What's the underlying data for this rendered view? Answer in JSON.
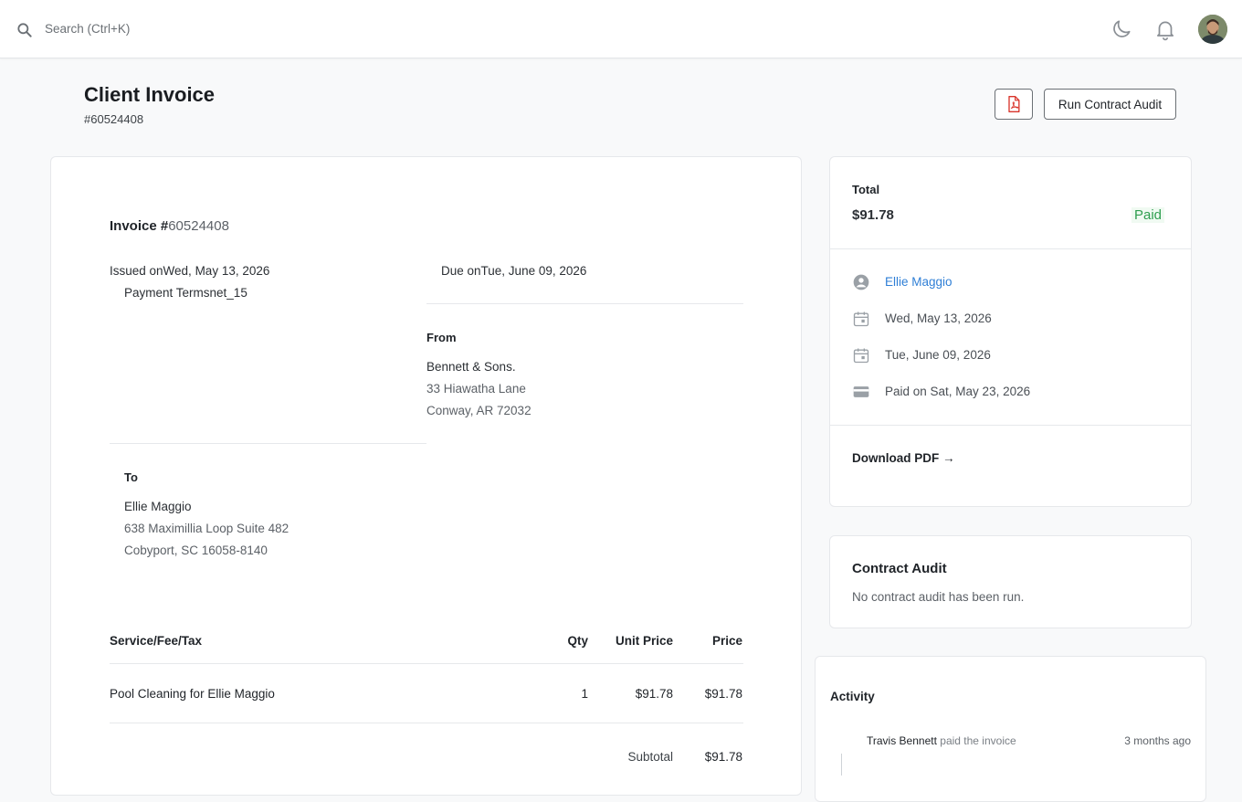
{
  "topbar": {
    "search_placeholder": "Search (Ctrl+K)"
  },
  "header": {
    "title": "Client Invoice",
    "subtitle": "#60524408",
    "audit_button": "Run Contract Audit"
  },
  "invoice": {
    "title_prefix": "Invoice #",
    "number": "60524408",
    "issued_label": "Issued on",
    "issued_date": "Wed, May 13, 2026",
    "due_label": "Due on",
    "due_date": "Tue, June 09, 2026",
    "terms_label": "Payment Terms",
    "terms_value": "net_15",
    "from": {
      "label": "From",
      "name": "Bennett & Sons.",
      "line1": "33 Hiawatha Lane",
      "line2": "Conway, AR 72032"
    },
    "to": {
      "label": "To",
      "name": "Ellie Maggio",
      "line1": "638 Maximillia Loop Suite 482",
      "line2": "Cobyport, SC 16058-8140"
    },
    "table": {
      "headers": [
        "Service/Fee/Tax",
        "Qty",
        "Unit Price",
        "Price"
      ],
      "rows": [
        {
          "service": "Pool Cleaning for Ellie Maggio",
          "qty": "1",
          "unit_price": "$91.78",
          "price": "$91.78"
        }
      ],
      "subtotal_label": "Subtotal",
      "subtotal_value": "$91.78"
    }
  },
  "summary": {
    "total_label": "Total",
    "total_value": "$91.78",
    "status": "Paid",
    "client": "Ellie Maggio",
    "issued": "Wed, May 13, 2026",
    "due": "Tue, June 09, 2026",
    "paid_on": "Paid on Sat, May 23, 2026",
    "download": "Download PDF →"
  },
  "contract_audit": {
    "title": "Contract Audit",
    "text": "No contract audit has been run."
  },
  "activity": {
    "title": "Activity",
    "items": [
      {
        "user": "Travis Bennett",
        "action": "paid the invoice",
        "time": "3 months ago"
      }
    ]
  },
  "colors": {
    "link": "#2f7fd6",
    "paid": "#2e9e4f",
    "pdf_red": "#d9342b"
  },
  "icons": [
    "search-icon",
    "moon-icon",
    "bell-icon",
    "pdf-icon",
    "account-circle-icon",
    "calendar-icon",
    "credit-card-icon"
  ]
}
